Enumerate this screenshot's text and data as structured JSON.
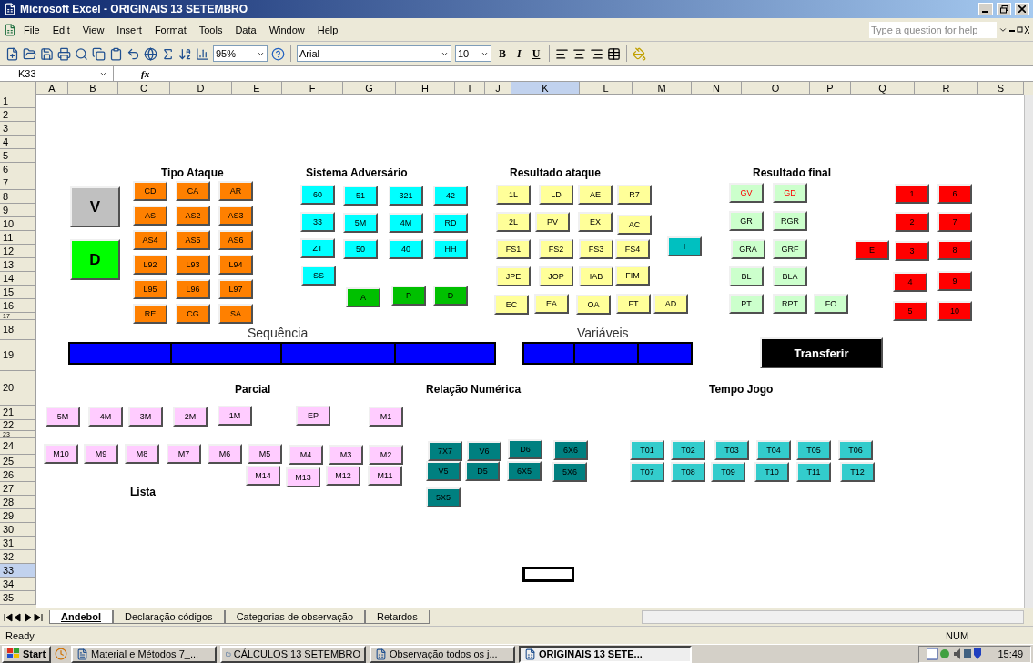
{
  "window": {
    "title": "Microsoft Excel - ORIGINAIS 13 SETEMBRO"
  },
  "menu": [
    "File",
    "Edit",
    "View",
    "Insert",
    "Format",
    "Tools",
    "Data",
    "Window",
    "Help"
  ],
  "help_search": {
    "placeholder": "Type a question for help"
  },
  "toolbar": {
    "zoom": "95%",
    "font": "Arial",
    "size": "10",
    "format_buttons": [
      "B",
      "I",
      "U"
    ]
  },
  "formula_bar": {
    "cell": "K33",
    "fx": "fx"
  },
  "columns": [
    {
      "label": "A",
      "selected": false
    },
    {
      "label": "B",
      "selected": false
    },
    {
      "label": "C",
      "selected": false
    },
    {
      "label": "D",
      "selected": false
    },
    {
      "label": "E",
      "selected": false
    },
    {
      "label": "F",
      "selected": false
    },
    {
      "label": "G",
      "selected": false
    },
    {
      "label": "H",
      "selected": false
    },
    {
      "label": "I",
      "selected": false
    },
    {
      "label": "J",
      "selected": false
    },
    {
      "label": "K",
      "selected": true
    },
    {
      "label": "L",
      "selected": false
    },
    {
      "label": "M",
      "selected": false
    },
    {
      "label": "N",
      "selected": false
    },
    {
      "label": "O",
      "selected": false
    },
    {
      "label": "P",
      "selected": false
    },
    {
      "label": "Q",
      "selected": false
    },
    {
      "label": "R",
      "selected": false
    },
    {
      "label": "S",
      "selected": false
    }
  ],
  "rows": [
    {
      "label": "1",
      "selected": false
    },
    {
      "label": "2",
      "selected": false
    },
    {
      "label": "3",
      "selected": false
    },
    {
      "label": "4",
      "selected": false
    },
    {
      "label": "5",
      "selected": false
    },
    {
      "label": "6",
      "selected": false
    },
    {
      "label": "7",
      "selected": false
    },
    {
      "label": "8",
      "selected": false
    },
    {
      "label": "9",
      "selected": false
    },
    {
      "label": "10",
      "selected": false
    },
    {
      "label": "11",
      "selected": false
    },
    {
      "label": "12",
      "selected": false
    },
    {
      "label": "13",
      "selected": false
    },
    {
      "label": "14",
      "selected": false
    },
    {
      "label": "15",
      "selected": false
    },
    {
      "label": "16",
      "selected": false
    },
    {
      "label": "17",
      "selected": false
    },
    {
      "label": "18",
      "selected": false
    },
    {
      "label": "19",
      "selected": false
    },
    {
      "label": "20",
      "selected": false
    },
    {
      "label": "21",
      "selected": false
    },
    {
      "label": "22",
      "selected": false
    },
    {
      "label": "23",
      "selected": false
    },
    {
      "label": "24",
      "selected": false
    },
    {
      "label": "25",
      "selected": false
    },
    {
      "label": "26",
      "selected": false
    },
    {
      "label": "27",
      "selected": false
    },
    {
      "label": "28",
      "selected": false
    },
    {
      "label": "29",
      "selected": false
    },
    {
      "label": "30",
      "selected": false
    },
    {
      "label": "31",
      "selected": false
    },
    {
      "label": "32",
      "selected": false
    },
    {
      "label": "33",
      "selected": true
    },
    {
      "label": "34",
      "selected": false
    },
    {
      "label": "35",
      "selected": false
    }
  ],
  "sheet": {
    "headings": [
      {
        "text": "Tipo Ataque",
        "kind": "bold"
      },
      {
        "text": "Sistema Adversário",
        "kind": "bold"
      },
      {
        "text": "Resultado ataque",
        "kind": "bold"
      },
      {
        "text": "Resultado final",
        "kind": "bold"
      },
      {
        "text": "Sequência",
        "kind": "plain"
      },
      {
        "text": "Variáveis",
        "kind": "plain"
      },
      {
        "text": "Parcial",
        "kind": "bold"
      },
      {
        "text": "Relação Numérica",
        "kind": "bold"
      },
      {
        "text": "Tempo Jogo",
        "kind": "bold"
      },
      {
        "text": "Lista",
        "kind": "underline"
      }
    ],
    "groups": [
      {
        "color": "#c0c0c0",
        "kind": "big",
        "buttons": [
          {
            "label": "V"
          }
        ]
      },
      {
        "color": "#00ff00",
        "kind": "big",
        "buttons": [
          {
            "label": "D"
          }
        ]
      },
      {
        "color": "#ff8000",
        "kind": "small",
        "buttons": [
          {
            "label": "CD"
          },
          {
            "label": "CA"
          },
          {
            "label": "AR"
          },
          {
            "label": "AS"
          },
          {
            "label": "AS2"
          },
          {
            "label": "AS3"
          },
          {
            "label": "AS4"
          },
          {
            "label": "AS5"
          },
          {
            "label": "AS6"
          },
          {
            "label": "L92"
          },
          {
            "label": "L93"
          },
          {
            "label": "L94"
          },
          {
            "label": "L95"
          },
          {
            "label": "L96"
          },
          {
            "label": "L97"
          },
          {
            "label": "RE"
          },
          {
            "label": "CG"
          },
          {
            "label": "SA"
          }
        ]
      },
      {
        "color": "#00ffff",
        "kind": "small",
        "buttons": [
          {
            "label": "60"
          },
          {
            "label": "51"
          },
          {
            "label": "321"
          },
          {
            "label": "42"
          },
          {
            "label": "33"
          },
          {
            "label": "5M"
          },
          {
            "label": "4M"
          },
          {
            "label": "RD"
          },
          {
            "label": "ZT"
          },
          {
            "label": "50"
          },
          {
            "label": "40"
          },
          {
            "label": "HH"
          },
          {
            "label": "SS"
          }
        ]
      },
      {
        "color": "#00c000",
        "kind": "small",
        "buttons": [
          {
            "label": "A"
          },
          {
            "label": "P"
          },
          {
            "label": "D"
          }
        ]
      },
      {
        "color": "#ffff99",
        "kind": "small",
        "buttons": [
          {
            "label": "1L"
          },
          {
            "label": "LD"
          },
          {
            "label": "AE"
          },
          {
            "label": "R7"
          },
          {
            "label": "2L"
          },
          {
            "label": "PV"
          },
          {
            "label": "EX"
          },
          {
            "label": "AC"
          },
          {
            "label": "FS1"
          },
          {
            "label": "FS2"
          },
          {
            "label": "FS3"
          },
          {
            "label": "FS4"
          },
          {
            "label": "JPE"
          },
          {
            "label": "JOP"
          },
          {
            "label": "IAB"
          },
          {
            "label": "FIM"
          },
          {
            "label": "EC"
          },
          {
            "label": "EA"
          },
          {
            "label": "OA"
          },
          {
            "label": "FT"
          },
          {
            "label": "AD"
          }
        ]
      },
      {
        "color": "#00c0c0",
        "kind": "small",
        "buttons": [
          {
            "label": "I"
          }
        ]
      },
      {
        "color": "#ccffcc",
        "kind": "small",
        "buttons": [
          {
            "label": "GV",
            "alert": true
          },
          {
            "label": "GD",
            "alert": true
          },
          {
            "label": "GR"
          },
          {
            "label": "RGR"
          },
          {
            "label": "GRA"
          },
          {
            "label": "GRF"
          },
          {
            "label": "BL"
          },
          {
            "label": "BLA"
          },
          {
            "label": "PT"
          },
          {
            "label": "RPT"
          },
          {
            "label": "FO"
          }
        ]
      },
      {
        "color": "#ff0000",
        "kind": "small",
        "buttons": [
          {
            "label": "1"
          },
          {
            "label": "6"
          },
          {
            "label": "2"
          },
          {
            "label": "7"
          },
          {
            "label": "E"
          },
          {
            "label": "3"
          },
          {
            "label": "8"
          },
          {
            "label": "4"
          },
          {
            "label": "9"
          },
          {
            "label": "5"
          },
          {
            "label": "10"
          }
        ]
      },
      {
        "color": "#000000",
        "kind": "wide",
        "buttons": [
          {
            "label": "Transferir"
          }
        ]
      },
      {
        "color": "#ffccff",
        "kind": "small",
        "buttons": [
          {
            "label": "5M"
          },
          {
            "label": "4M"
          },
          {
            "label": "3M"
          },
          {
            "label": "2M"
          },
          {
            "label": "1M"
          },
          {
            "label": "EP"
          },
          {
            "label": "M1"
          },
          {
            "label": "M10"
          },
          {
            "label": "M9"
          },
          {
            "label": "M8"
          },
          {
            "label": "M7"
          },
          {
            "label": "M6"
          },
          {
            "label": "M5"
          },
          {
            "label": "M4"
          },
          {
            "label": "M3"
          },
          {
            "label": "M2"
          },
          {
            "label": "M14"
          },
          {
            "label": "M13"
          },
          {
            "label": "M12"
          },
          {
            "label": "M11"
          }
        ]
      },
      {
        "color": "#008080",
        "kind": "small",
        "buttons": [
          {
            "label": "7X7"
          },
          {
            "label": "V6"
          },
          {
            "label": "D6"
          },
          {
            "label": "6X6"
          },
          {
            "label": "V5"
          },
          {
            "label": "D5"
          },
          {
            "label": "6X5"
          },
          {
            "label": "5X6"
          },
          {
            "label": "5X5"
          }
        ]
      },
      {
        "color": "#33cccc",
        "kind": "small",
        "buttons": [
          {
            "label": "T01"
          },
          {
            "label": "T02"
          },
          {
            "label": "T03"
          },
          {
            "label": "T04"
          },
          {
            "label": "T05"
          },
          {
            "label": "T06"
          },
          {
            "label": "T07"
          },
          {
            "label": "T08"
          },
          {
            "label": "T09"
          },
          {
            "label": "T10"
          },
          {
            "label": "T11"
          },
          {
            "label": "T12"
          }
        ]
      }
    ]
  },
  "sheet_tabs": [
    {
      "label": "Andebol",
      "selected": true
    },
    {
      "label": "Declaração códigos",
      "selected": false
    },
    {
      "label": "Categorias de observação",
      "selected": false
    },
    {
      "label": "Retardos",
      "selected": false
    }
  ],
  "status_bar": {
    "text": "Ready",
    "num": "NUM"
  },
  "taskbar": {
    "start": "Start",
    "items": [
      {
        "label": "Material e Métodos 7_...",
        "selected": false
      },
      {
        "label": "CÁLCULOS 13 SETEMBRO",
        "selected": false
      },
      {
        "label": "Observação todos os j...",
        "selected": false
      },
      {
        "label": "ORIGINAIS 13 SETE...",
        "selected": true
      }
    ],
    "clock": "15:49"
  }
}
